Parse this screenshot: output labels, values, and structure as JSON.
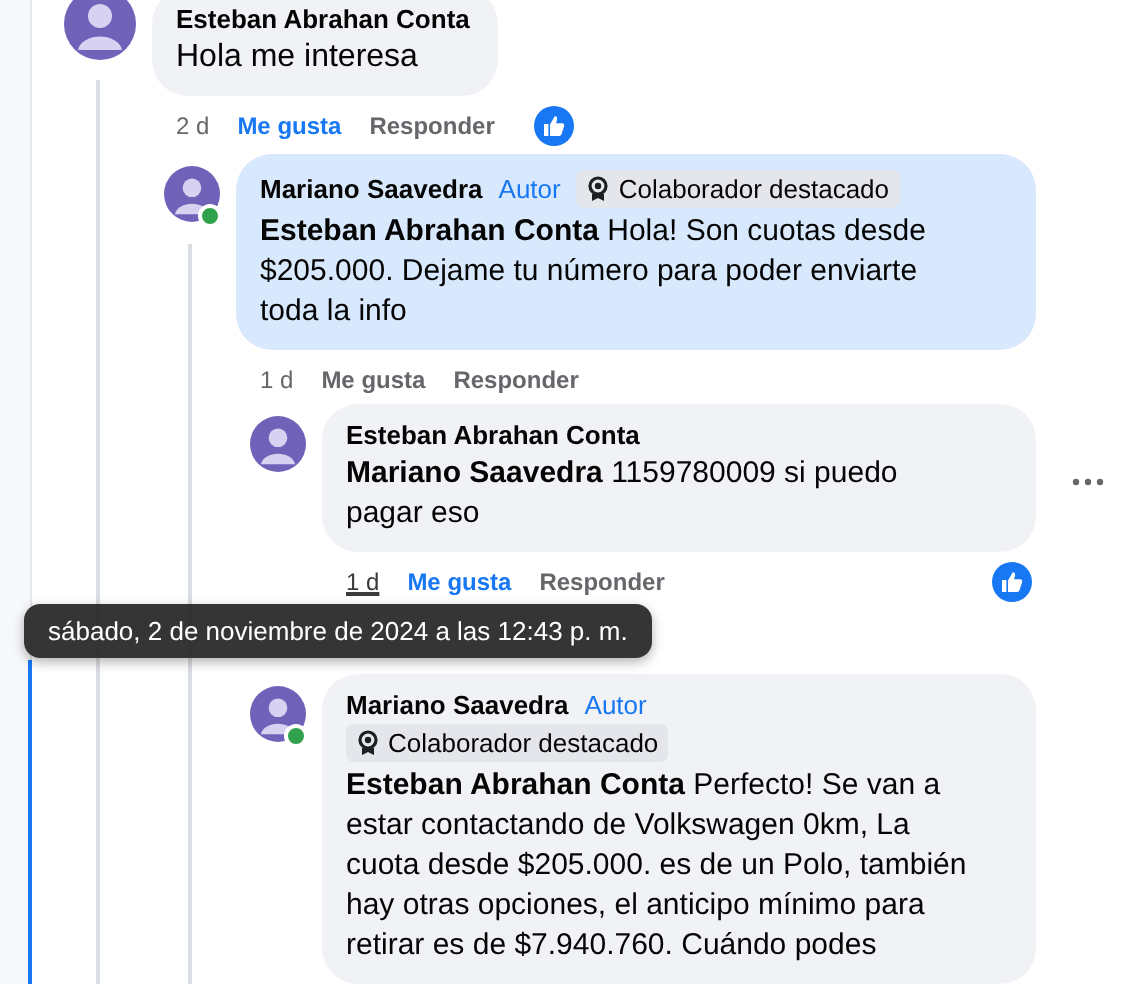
{
  "comments": [
    {
      "author": "Esteban Abrahan Conta",
      "text": "Hola me interesa",
      "time": "2 d",
      "time_hovered": false,
      "like_label": "Me gusta",
      "liked": true,
      "reply_label": "Responder",
      "has_reaction": true,
      "online": false,
      "highlighted": false,
      "children": [
        {
          "author": "Mariano Saavedra",
          "role": "Autor",
          "badge": "Colaborador destacado",
          "text": "**Esteban Abrahan Conta** Hola! Son cuotas desde $205.000. Dejame tu número para poder enviarte toda la info",
          "time": "1 d",
          "time_hovered": false,
          "like_label": "Me gusta",
          "liked": false,
          "reply_label": "Responder",
          "has_reaction": false,
          "online": true,
          "highlighted": true,
          "children": [
            {
              "author": "Esteban Abrahan Conta",
              "text": "**Mariano Saavedra** 1159780009 si puedo pagar eso",
              "time": "1 d",
              "time_hovered": true,
              "like_label": "Me gusta",
              "liked": true,
              "reply_label": "Responder",
              "has_reaction": true,
              "online": false,
              "highlighted": false,
              "more_menu": true
            },
            {
              "author": "Mariano Saavedra",
              "role": "Autor",
              "badge": "Colaborador destacado",
              "text": "**Esteban Abrahan Conta** Perfecto! Se van a estar contactando de Volkswagen 0km, La cuota desde $205.000. es de un Polo, también hay otras opciones, el anticipo mínimo para retirar es de $7.940.760. Cuándo podes",
              "online": true,
              "highlighted": false
            }
          ]
        }
      ]
    }
  ],
  "tooltip": {
    "text": "sábado, 2 de noviembre de 2024 a las 12:43 p. m."
  }
}
